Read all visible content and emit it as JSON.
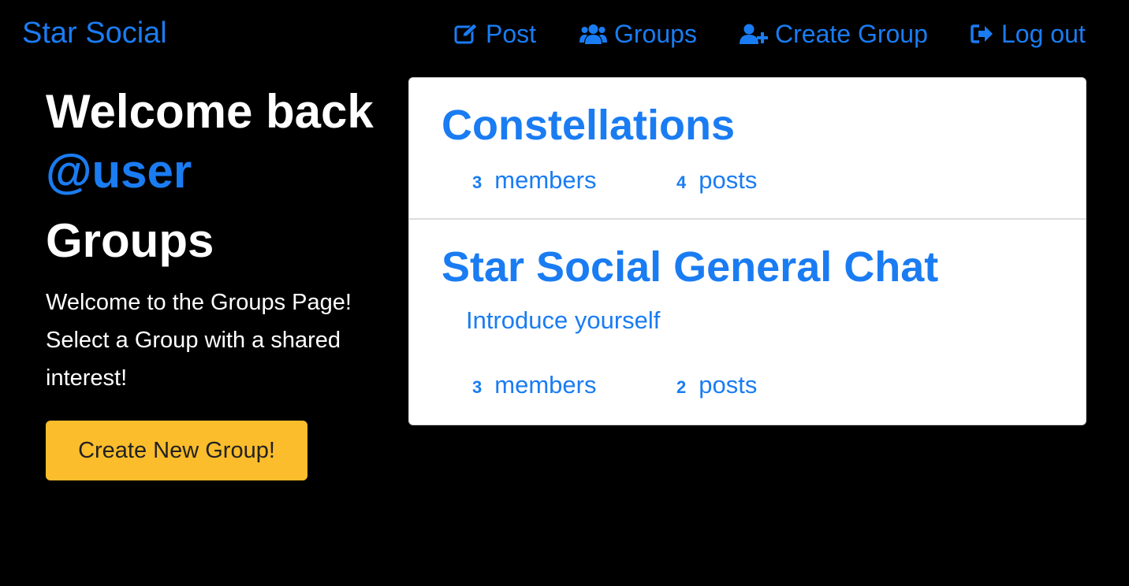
{
  "navbar": {
    "brand": "Star Social",
    "links": [
      {
        "label": "Post",
        "icon": "edit-icon"
      },
      {
        "label": "Groups",
        "icon": "users-icon"
      },
      {
        "label": "Create Group",
        "icon": "user-plus-icon"
      },
      {
        "label": "Log out",
        "icon": "sign-out-icon"
      }
    ]
  },
  "sidebar": {
    "welcome_text": "Welcome back",
    "username": "@user",
    "title": "Groups",
    "intro": "Welcome to the Groups Page! Select a Group with a shared interest!",
    "create_button": "Create New Group!"
  },
  "groups": [
    {
      "name": "Constellations",
      "description": "",
      "members_count": "3",
      "members_label": "members",
      "posts_count": "4",
      "posts_label": "posts"
    },
    {
      "name": "Star Social General Chat",
      "description": "Introduce yourself",
      "members_count": "3",
      "members_label": "members",
      "posts_count": "2",
      "posts_label": "posts"
    }
  ],
  "colors": {
    "background": "#000000",
    "accent": "#1a7cf2",
    "button": "#fbbd2b",
    "card": "#ffffff"
  }
}
